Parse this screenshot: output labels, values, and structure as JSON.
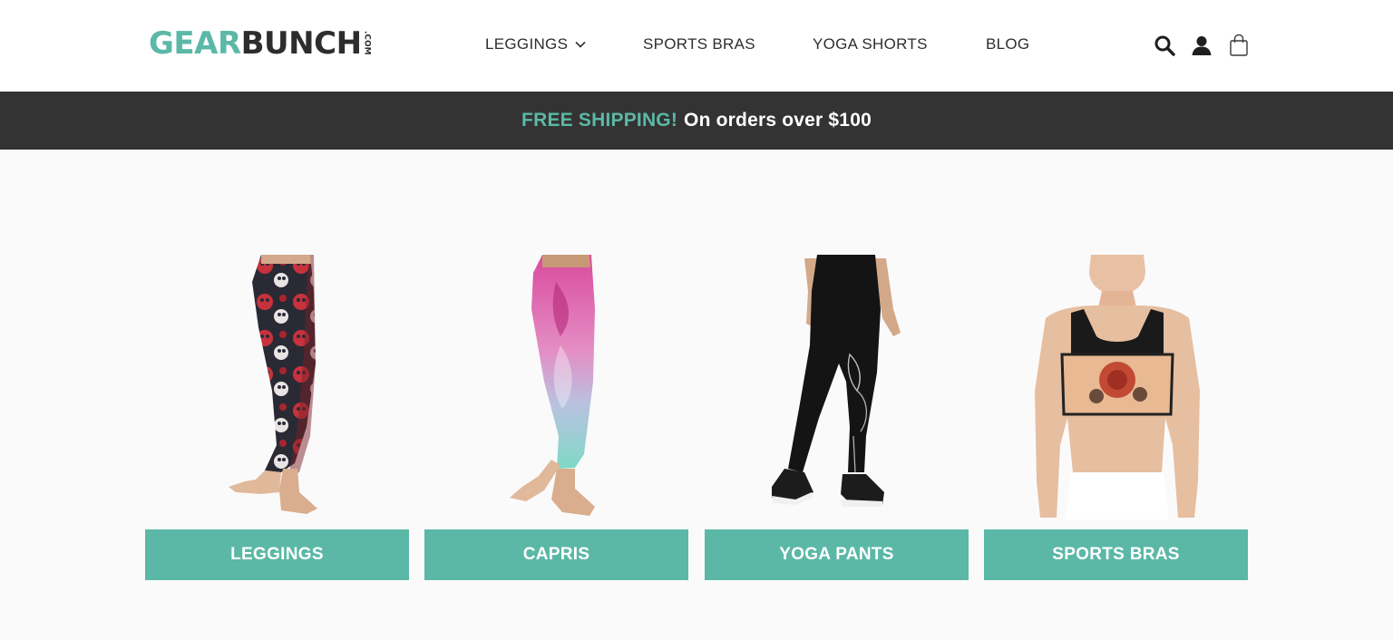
{
  "brand": {
    "logo_primary": "GEAR",
    "logo_secondary": "BUNCH",
    "logo_suffix": ".COM",
    "accent_color": "#5bb8a6",
    "dark_color": "#333333"
  },
  "nav": {
    "items": [
      {
        "label": "LEGGINGS",
        "has_dropdown": true
      },
      {
        "label": "SPORTS BRAS"
      },
      {
        "label": "YOGA SHORTS"
      },
      {
        "label": "BLOG"
      }
    ],
    "icons": [
      "search-icon",
      "account-icon",
      "cart-bag-icon"
    ]
  },
  "promo": {
    "highlight": "FREE SHIPPING!",
    "text": "On orders over $100"
  },
  "categories": [
    {
      "label": "LEGGINGS",
      "image": "patterned sugar-skull leggings"
    },
    {
      "label": "CAPRIS",
      "image": "pink-to-mint ornate capri leggings"
    },
    {
      "label": "YOGA PANTS",
      "image": "black lotus-print yoga pants"
    },
    {
      "label": "SPORTS BRAS",
      "image": "floral print sports bra"
    }
  ]
}
